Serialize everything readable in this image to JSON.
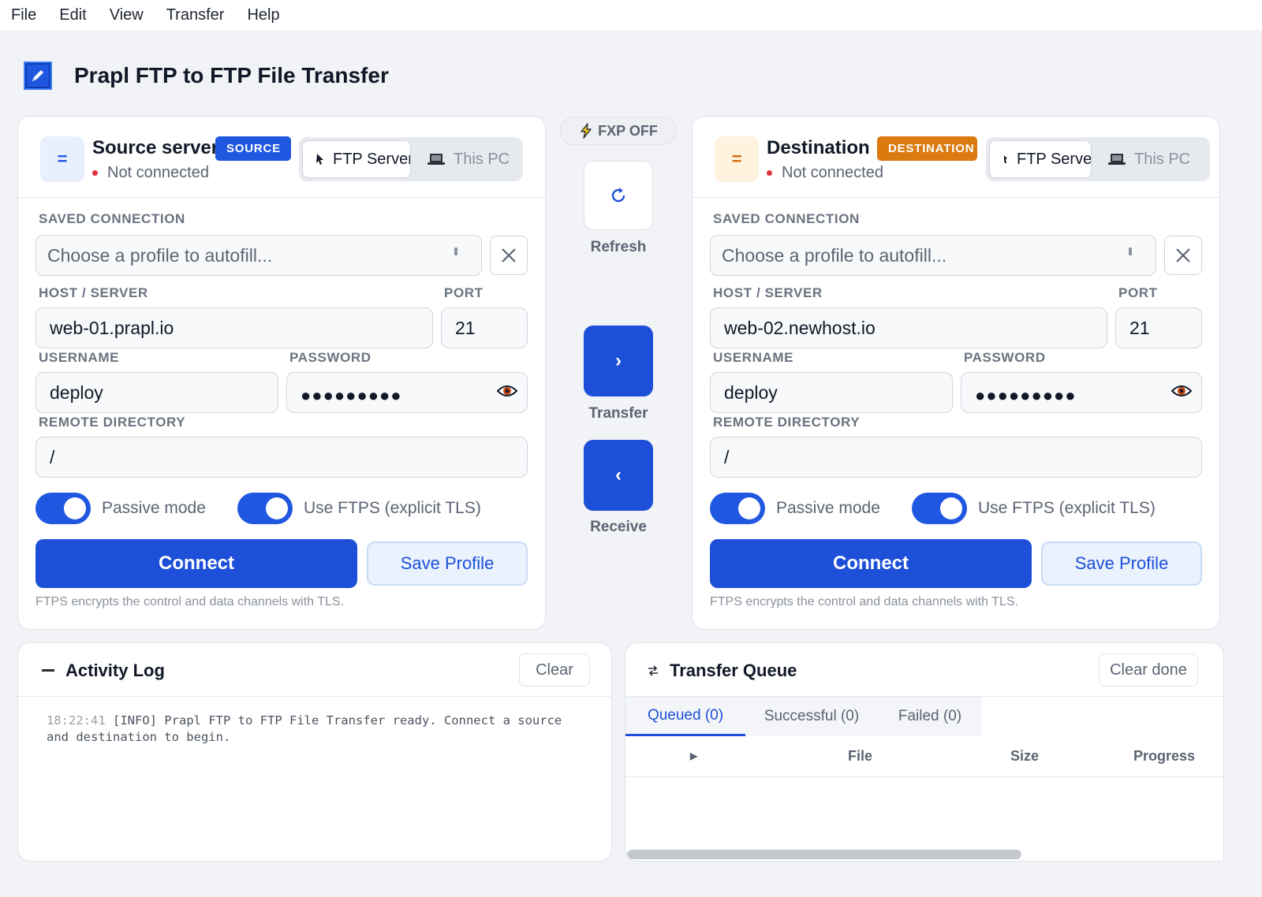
{
  "menu": [
    "File",
    "Edit",
    "View",
    "Transfer",
    "Help"
  ],
  "app": {
    "title": "Prapl FTP to FTP File Transfer"
  },
  "source": {
    "title": "Source server",
    "badge": "SOURCE",
    "status": "Not connected",
    "mode_tabs": [
      "FTP Server",
      "This PC"
    ],
    "saved_label": "SAVED CONNECTION",
    "saved_placeholder": "Choose a profile to autofill...",
    "host_label": "HOST / SERVER",
    "host": "web-01.prapl.io",
    "port_label": "PORT",
    "port": "21",
    "user_label": "USERNAME",
    "username": "deploy",
    "pass_label": "PASSWORD",
    "password_mask": "●●●●●●●●●",
    "dir_label": "REMOTE DIRECTORY",
    "directory": "/",
    "passive_label": "Passive mode",
    "passive_on": true,
    "ftps_label": "Use FTPS (explicit TLS)",
    "ftps_on": true,
    "connect": "Connect",
    "save": "Save Profile",
    "hint": "FTPS encrypts the control and data channels with TLS."
  },
  "destination": {
    "title": "Destination",
    "badge": "DESTINATION",
    "status": "Not connected",
    "mode_tabs": [
      "FTP Server",
      "This PC"
    ],
    "saved_label": "SAVED CONNECTION",
    "saved_placeholder": "Choose a profile to autofill...",
    "host_label": "HOST / SERVER",
    "host": "web-02.newhost.io",
    "port_label": "PORT",
    "port": "21",
    "user_label": "USERNAME",
    "username": "deploy",
    "pass_label": "PASSWORD",
    "password_mask": "●●●●●●●●●",
    "dir_label": "REMOTE DIRECTORY",
    "directory": "/",
    "passive_label": "Passive mode",
    "passive_on": true,
    "ftps_label": "Use FTPS (explicit TLS)",
    "ftps_on": true,
    "connect": "Connect",
    "save": "Save Profile",
    "hint": "FTPS encrypts the control and data channels with TLS."
  },
  "center": {
    "fxp": "FXP OFF",
    "refresh": "Refresh",
    "transfer": "Transfer",
    "transfer_glyph": "›",
    "receive": "Receive",
    "receive_glyph": "‹"
  },
  "log": {
    "title": "Activity Log",
    "clear": "Clear",
    "entries": [
      {
        "time": "18:22:41",
        "level": "[INFO]",
        "message": "Prapl FTP to FTP File Transfer ready. Connect a source and destination to begin."
      }
    ]
  },
  "queue": {
    "title": "Transfer Queue",
    "clear_done": "Clear done",
    "tabs": [
      {
        "label": "Queued  (0)",
        "active": true
      },
      {
        "label": "Successful  (0)",
        "active": false
      },
      {
        "label": "Failed  (0)",
        "active": false
      }
    ],
    "columns": [
      "File",
      "Size",
      "Progress"
    ]
  },
  "colors": {
    "accent": "#1d4fd8",
    "source_badge": "#1f57e0",
    "destination_badge": "#db7a0f",
    "status_dot": "#e0323c"
  },
  "icons": {
    "logo": "pencil-icon",
    "server": "equals-icon",
    "ftp_mode": "pointer-icon",
    "pc_mode": "laptop-icon",
    "clear": "close-icon",
    "password": "eye-icon",
    "fxp": "bolt-icon",
    "refresh": "refresh-icon",
    "log": "log-icon",
    "queue": "swap-icon"
  }
}
